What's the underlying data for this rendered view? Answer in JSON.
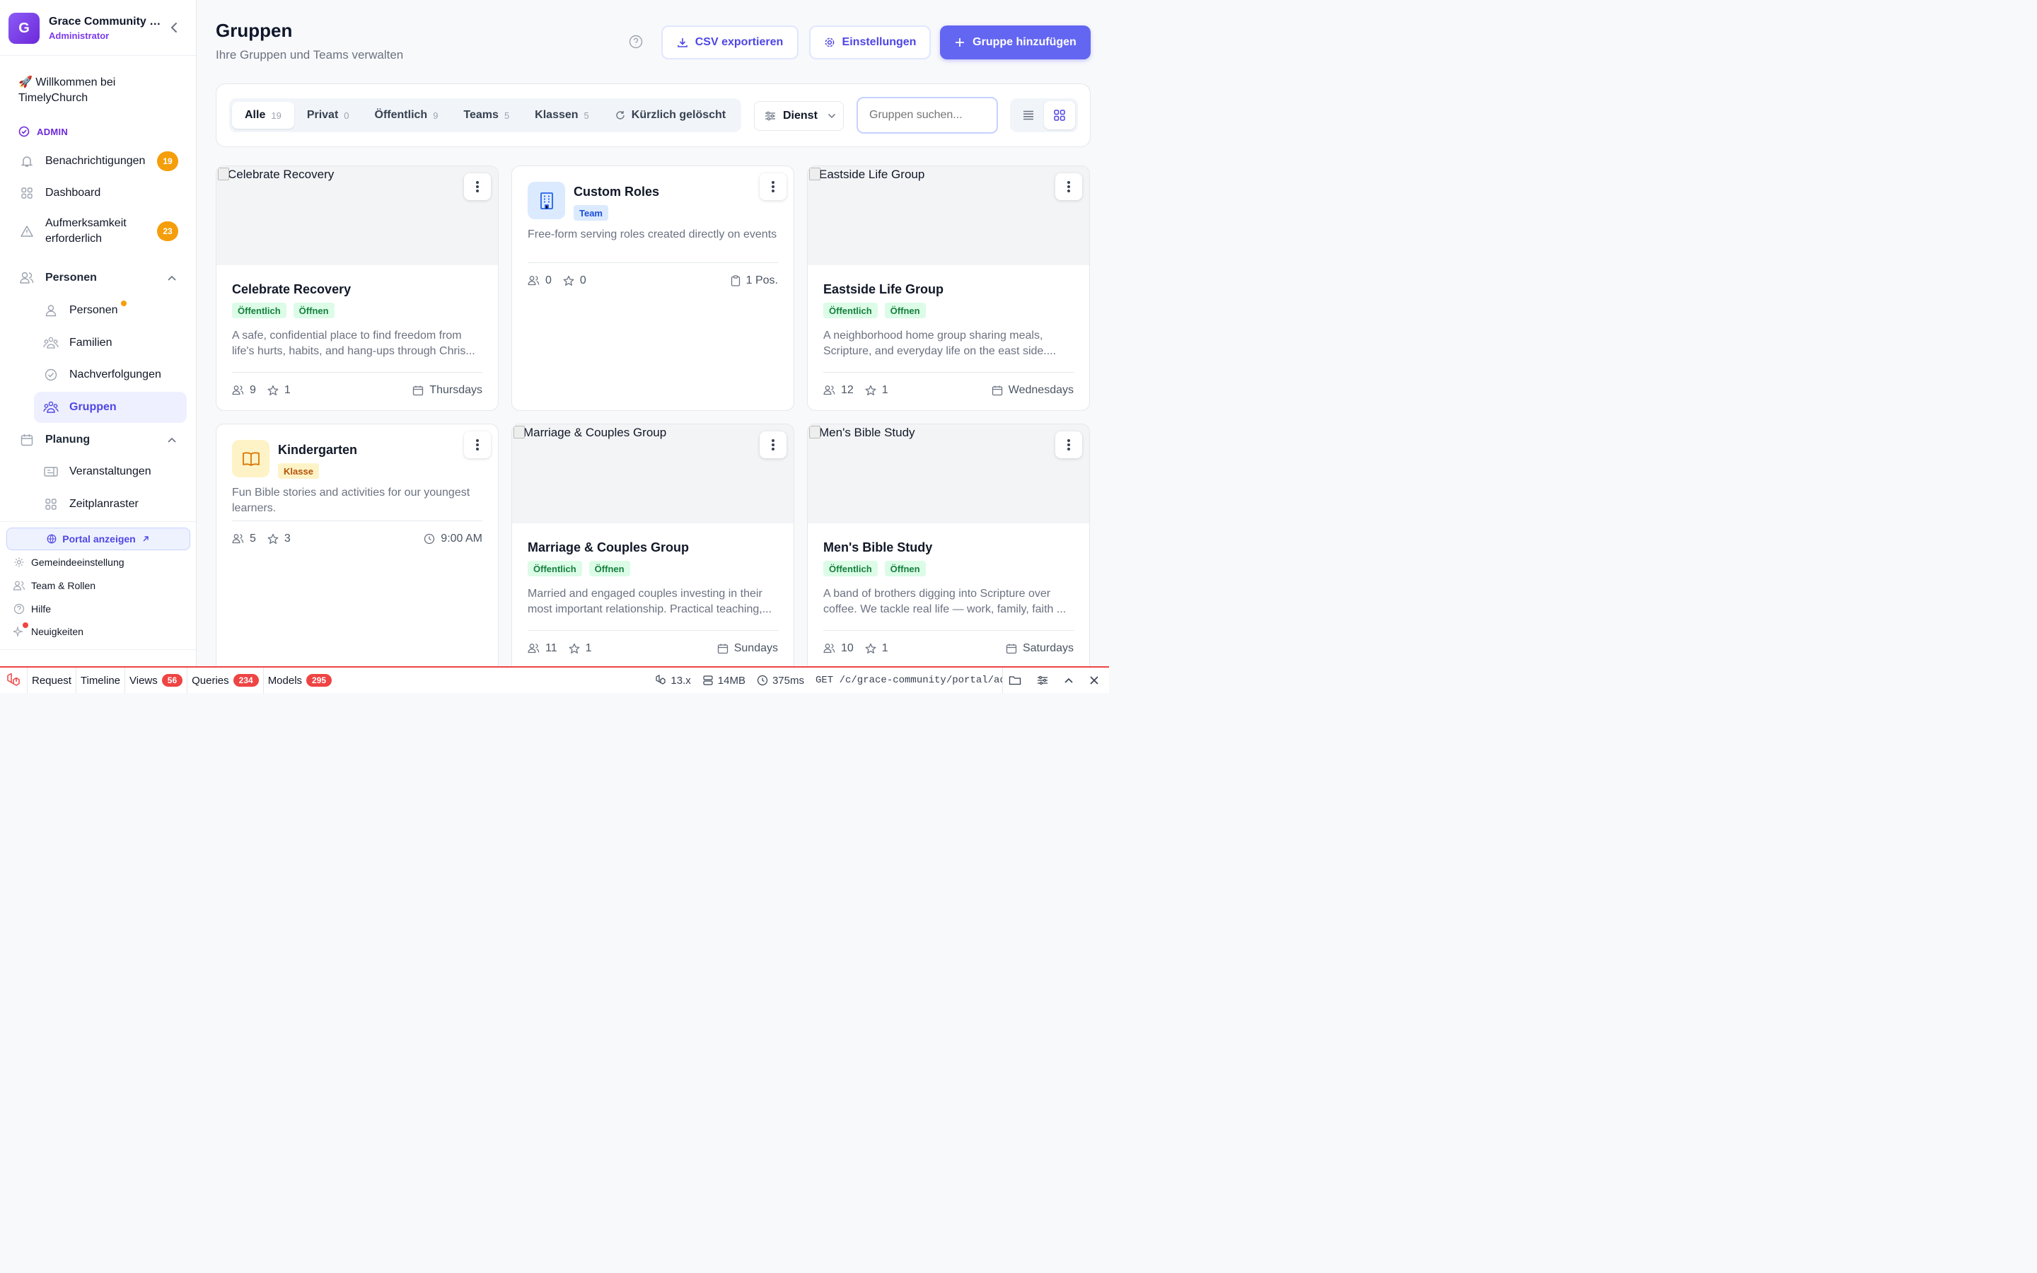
{
  "sidebar": {
    "org_initial": "G",
    "org_name": "Grace Community Church",
    "org_role": "Administrator",
    "welcome": "🚀 Willkommen bei TimelyChurch",
    "admin_label": "ADMIN",
    "items": [
      {
        "label": "Benachrichtigungen",
        "badge": "19"
      },
      {
        "label": "Dashboard"
      },
      {
        "label": "Aufmerksamkeit erforderlich",
        "badge": "23"
      }
    ],
    "people_section": "Personen",
    "people_items": [
      "Personen",
      "Familien",
      "Nachverfolgungen",
      "Gruppen"
    ],
    "planning_section": "Planung",
    "planning_items": [
      "Veranstaltungen",
      "Zeitplanraster"
    ],
    "portal_label": "Portal anzeigen",
    "footer_items": [
      "Gemeindeeinstellung",
      "Team & Rollen",
      "Hilfe",
      "Neuigkeiten"
    ]
  },
  "header": {
    "title": "Gruppen",
    "subtitle": "Ihre Gruppen und Teams verwalten",
    "export_label": "CSV exportieren",
    "settings_label": "Einstellungen",
    "add_label": "Gruppe hinzufügen"
  },
  "filters": {
    "tabs": [
      {
        "label": "Alle",
        "count": "19"
      },
      {
        "label": "Privat",
        "count": "0"
      },
      {
        "label": "Öffentlich",
        "count": "9"
      },
      {
        "label": "Teams",
        "count": "5"
      },
      {
        "label": "Klassen",
        "count": "5"
      }
    ],
    "deleted_label": "Kürzlich gelöscht",
    "select_value": "Dienst",
    "search_placeholder": "Gruppen suchen..."
  },
  "cards": [
    {
      "img_alt": "Celebrate Recovery",
      "name": "Celebrate Recovery",
      "tags": [
        "Öffentlich",
        "Öffnen"
      ],
      "desc": "A safe, confidential place to find freedom from life's hurts, habits, and hang-ups through Chris...",
      "members": "9",
      "leaders": "1",
      "schedule": "Thursdays"
    },
    {
      "name": "Custom Roles",
      "tags": [
        "Team"
      ],
      "desc": "Free-form serving roles created directly on events",
      "members": "0",
      "leaders": "0",
      "schedule": "1 Pos."
    },
    {
      "img_alt": "Eastside Life Group",
      "name": "Eastside Life Group",
      "tags": [
        "Öffentlich",
        "Öffnen"
      ],
      "desc": "A neighborhood home group sharing meals, Scripture, and everyday life on the east side....",
      "members": "12",
      "leaders": "1",
      "schedule": "Wednesdays"
    },
    {
      "name": "Kindergarten",
      "tags": [
        "Klasse"
      ],
      "desc": "Fun Bible stories and activities for our youngest learners.",
      "members": "5",
      "leaders": "3",
      "schedule": "9:00 AM"
    },
    {
      "img_alt": "Marriage & Couples Group",
      "name": "Marriage & Couples Group",
      "tags": [
        "Öffentlich",
        "Öffnen"
      ],
      "desc": "Married and engaged couples investing in their most important relationship. Practical teaching,...",
      "members": "11",
      "leaders": "1",
      "schedule": "Sundays"
    },
    {
      "img_alt": "Men's Bible Study",
      "name": "Men's Bible Study",
      "tags": [
        "Öffentlich",
        "Öffnen"
      ],
      "desc": "A band of brothers digging into Scripture over coffee. We tackle real life — work, family, faith ...",
      "members": "10",
      "leaders": "1",
      "schedule": "Saturdays"
    }
  ],
  "debugbar": {
    "tabs": [
      {
        "label": "Request"
      },
      {
        "label": "Timeline"
      },
      {
        "label": "Views",
        "count": "56"
      },
      {
        "label": "Queries",
        "count": "234"
      },
      {
        "label": "Models",
        "count": "295"
      }
    ],
    "version": "13.x",
    "memory": "14MB",
    "time": "375ms",
    "route": "GET /c/grace-community/portal/admin/groups"
  },
  "colors": {
    "accent": "#6366f1",
    "warning": "#f59e0b",
    "debug": "#ef4444"
  }
}
